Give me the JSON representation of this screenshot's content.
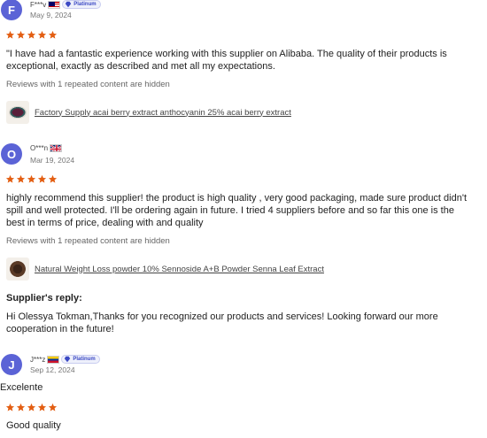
{
  "reviews": [
    {
      "initial": "F",
      "name": "F***v",
      "date": "May 9, 2024",
      "badge": "Platinum",
      "rating": 5,
      "text": "\"I have had a fantastic experience working with this supplier on Alibaba. The quality of their products is exceptional, exactly as described and met all my expectations.",
      "hidden_note": "Reviews with 1 repeated content are hidden",
      "product": "Factory Supply acai berry extract anthocyanin 25% acai berry extract"
    },
    {
      "initial": "O",
      "name": "O***n",
      "date": "Mar 19, 2024",
      "rating": 5,
      "text": "highly recommend this supplier! the product is high quality , very good packaging, made sure product didn't spill and well protected. I'll be ordering again in future. I tried 4 suppliers before and so far this one is the best in terms of price, dealing with and quality",
      "hidden_note": "Reviews with 1 repeated content are hidden",
      "product": "Natural Weight Loss powder 10% Sennoside A+B Powder Senna Leaf Extract",
      "reply_title": "Supplier's reply:",
      "reply_text": "Hi Olessya Tokman,Thanks for you recognized our products and services! Looking forward our more cooperation in the future!"
    },
    {
      "initial": "J",
      "name": "J***z",
      "date": "Sep 12, 2024",
      "badge": "Platinum",
      "title": "Excelente",
      "rating": 5,
      "text": "Good quality"
    }
  ],
  "colors": {
    "avatar": "#5b63d6",
    "star": "#e35e12",
    "badge": "#3b49c4"
  }
}
